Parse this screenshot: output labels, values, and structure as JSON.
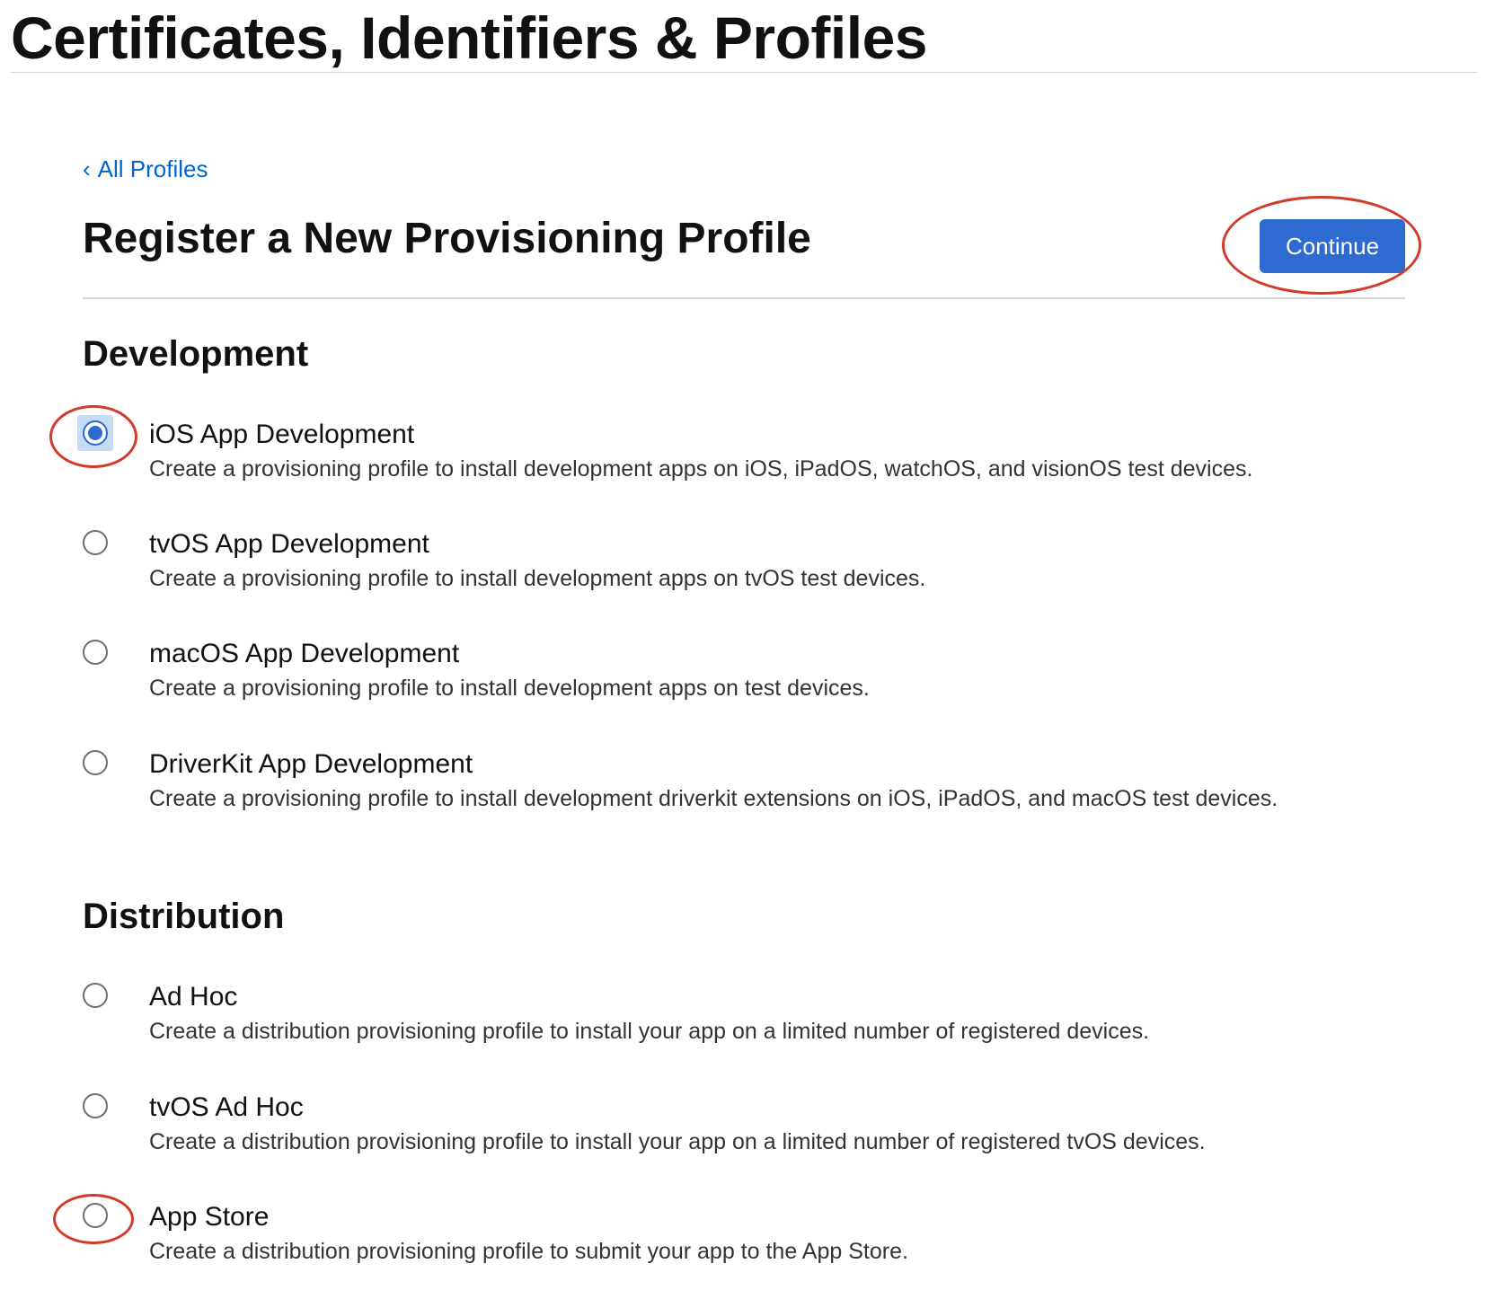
{
  "app": {
    "title": "Certificates, Identifiers & Profiles"
  },
  "breadcrumb": {
    "chevron": "‹",
    "label": "All Profiles"
  },
  "page": {
    "heading": "Register a New Provisioning Profile",
    "continue_label": "Continue"
  },
  "sections": {
    "development": {
      "title": "Development",
      "options": [
        {
          "title": "iOS App Development",
          "description": "Create a provisioning profile to install development apps on iOS, iPadOS, watchOS, and visionOS test devices.",
          "selected": true
        },
        {
          "title": "tvOS App Development",
          "description": "Create a provisioning profile to install development apps on tvOS test devices.",
          "selected": false
        },
        {
          "title": "macOS App Development",
          "description": "Create a provisioning profile to install development apps on test devices.",
          "selected": false
        },
        {
          "title": "DriverKit App Development",
          "description": "Create a provisioning profile to install development driverkit extensions on iOS, iPadOS, and macOS test devices.",
          "selected": false
        }
      ]
    },
    "distribution": {
      "title": "Distribution",
      "options": [
        {
          "title": "Ad Hoc",
          "description": "Create a distribution provisioning profile to install your app on a limited number of registered devices.",
          "selected": false
        },
        {
          "title": "tvOS Ad Hoc",
          "description": "Create a distribution provisioning profile to install your app on a limited number of registered tvOS devices.",
          "selected": false
        },
        {
          "title": "App Store",
          "description": "Create a distribution provisioning profile to submit your app to the App Store.",
          "selected": false
        }
      ]
    }
  },
  "colors": {
    "accent": "#2d6bd1",
    "link": "#0066cc",
    "annotation": "#d23b2b"
  }
}
